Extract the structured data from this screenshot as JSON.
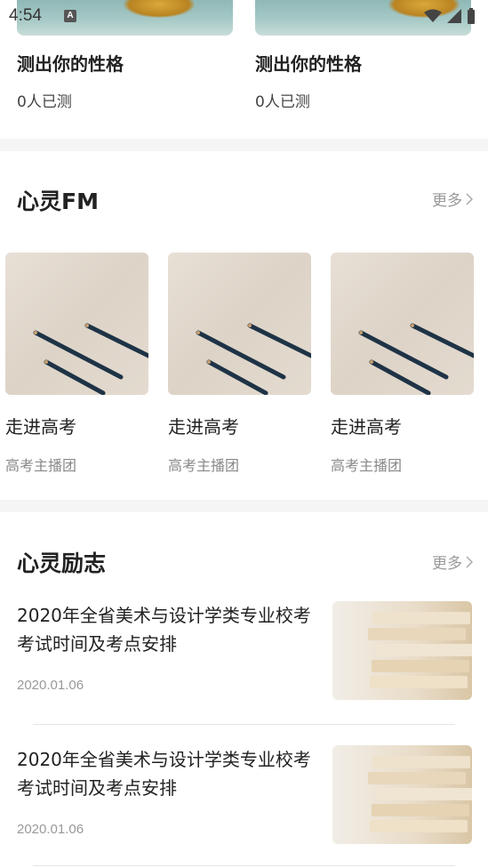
{
  "status_bar": {
    "time": "4:54",
    "notification_letter": "A"
  },
  "test_cards": [
    {
      "title": "测出你的性格",
      "count": "0人已测"
    },
    {
      "title": "测出你的性格",
      "count": "0人已测"
    }
  ],
  "fm_section": {
    "title": "心灵FM",
    "more_label": "更多",
    "items": [
      {
        "title": "走进高考",
        "subtitle": "高考主播团"
      },
      {
        "title": "走进高考",
        "subtitle": "高考主播团"
      },
      {
        "title": "走进高考",
        "subtitle": "高考主播团"
      }
    ]
  },
  "inspire_section": {
    "title": "心灵励志",
    "more_label": "更多",
    "articles": [
      {
        "title": "2020年全省美术与设计学类专业校考考试时间及考点安排",
        "date": "2020.01.06"
      },
      {
        "title": "2020年全省美术与设计学类专业校考考试时间及考点安排",
        "date": "2020.01.06"
      }
    ]
  },
  "colors": {
    "divider": "#f5f5f5",
    "muted_text": "#999999",
    "primary_text": "#222222"
  }
}
